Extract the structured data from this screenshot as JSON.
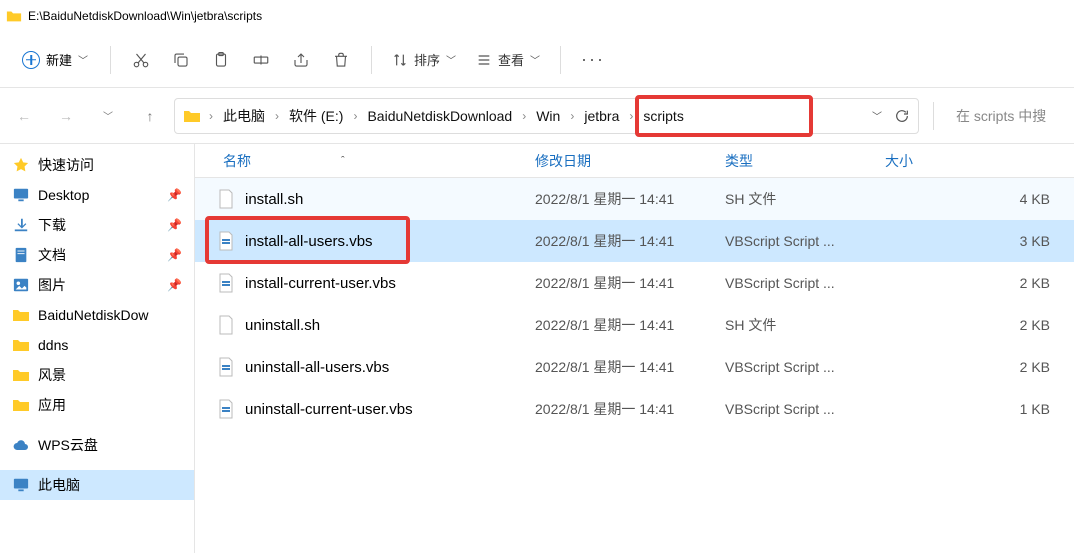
{
  "titlebar": {
    "path": "E:\\BaiduNetdiskDownload\\Win\\jetbra\\scripts"
  },
  "toolbar": {
    "new_label": "新建",
    "sort_label": "排序",
    "view_label": "查看"
  },
  "breadcrumbs": {
    "items": [
      "此电脑",
      "软件 (E:)",
      "BaiduNetdiskDownload",
      "Win",
      "jetbra",
      "scripts"
    ]
  },
  "search": {
    "placeholder": "在 scripts 中搜"
  },
  "sidebar": {
    "items": [
      {
        "label": "快速访问",
        "icon": "star",
        "pinned": false
      },
      {
        "label": "Desktop",
        "icon": "desktop",
        "pinned": true
      },
      {
        "label": "下载",
        "icon": "download",
        "pinned": true
      },
      {
        "label": "文档",
        "icon": "doc",
        "pinned": true
      },
      {
        "label": "图片",
        "icon": "picture",
        "pinned": true
      },
      {
        "label": "BaiduNetdiskDow",
        "icon": "folder",
        "pinned": false
      },
      {
        "label": "ddns",
        "icon": "folder",
        "pinned": false
      },
      {
        "label": "风景",
        "icon": "folder",
        "pinned": false
      },
      {
        "label": "应用",
        "icon": "folder",
        "pinned": false
      },
      {
        "label": "WPS云盘",
        "icon": "cloud",
        "pinned": false
      },
      {
        "label": "此电脑",
        "icon": "pc",
        "pinned": false
      }
    ]
  },
  "columns": {
    "name": "名称",
    "date": "修改日期",
    "type": "类型",
    "size": "大小"
  },
  "files": [
    {
      "name": "install.sh",
      "date": "2022/8/1 星期一 14:41",
      "type": "SH 文件",
      "size": "4 KB",
      "icon": "sh",
      "alt": true
    },
    {
      "name": "install-all-users.vbs",
      "date": "2022/8/1 星期一 14:41",
      "type": "VBScript Script ...",
      "size": "3 KB",
      "icon": "vbs",
      "selected": true,
      "highlighted": true
    },
    {
      "name": "install-current-user.vbs",
      "date": "2022/8/1 星期一 14:41",
      "type": "VBScript Script ...",
      "size": "2 KB",
      "icon": "vbs"
    },
    {
      "name": "uninstall.sh",
      "date": "2022/8/1 星期一 14:41",
      "type": "SH 文件",
      "size": "2 KB",
      "icon": "sh"
    },
    {
      "name": "uninstall-all-users.vbs",
      "date": "2022/8/1 星期一 14:41",
      "type": "VBScript Script ...",
      "size": "2 KB",
      "icon": "vbs"
    },
    {
      "name": "uninstall-current-user.vbs",
      "date": "2022/8/1 星期一 14:41",
      "type": "VBScript Script ...",
      "size": "1 KB",
      "icon": "vbs"
    }
  ]
}
